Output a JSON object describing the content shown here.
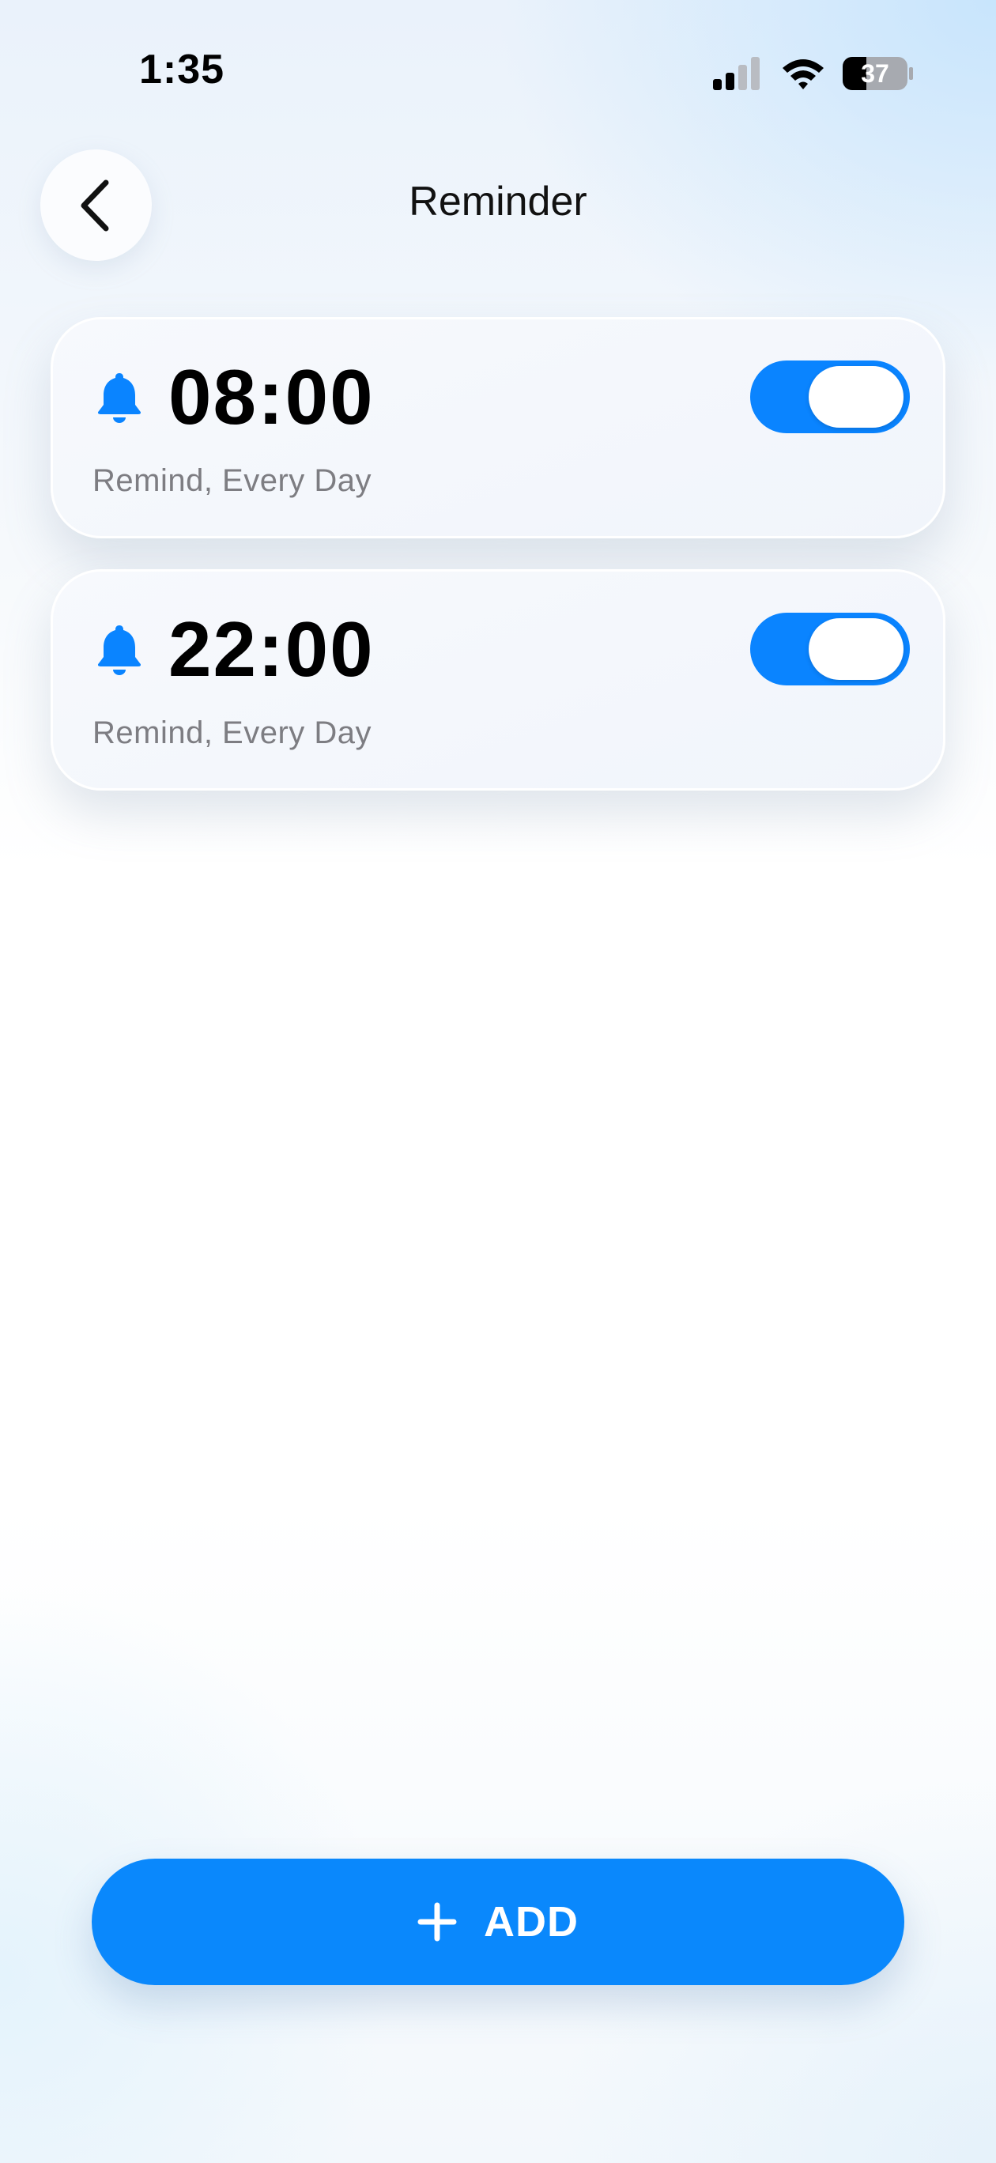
{
  "status_bar": {
    "time": "1:35",
    "battery": "37",
    "signal_icon": "cellular-signal-icon",
    "wifi_icon": "wifi-icon",
    "battery_icon": "battery-icon"
  },
  "header": {
    "title": "Reminder",
    "back_icon": "chevron-left-icon"
  },
  "reminders": [
    {
      "time": "08:00",
      "repeat": "Remind, Every Day",
      "enabled": true,
      "icon": "bell-icon"
    },
    {
      "time": "22:00",
      "repeat": "Remind, Every Day",
      "enabled": true,
      "icon": "bell-icon"
    }
  ],
  "add_button": {
    "label": "ADD",
    "icon": "plus-icon"
  },
  "colors": {
    "accent": "#0a84ff",
    "text_primary": "#000000",
    "text_secondary": "#7d7d82"
  }
}
